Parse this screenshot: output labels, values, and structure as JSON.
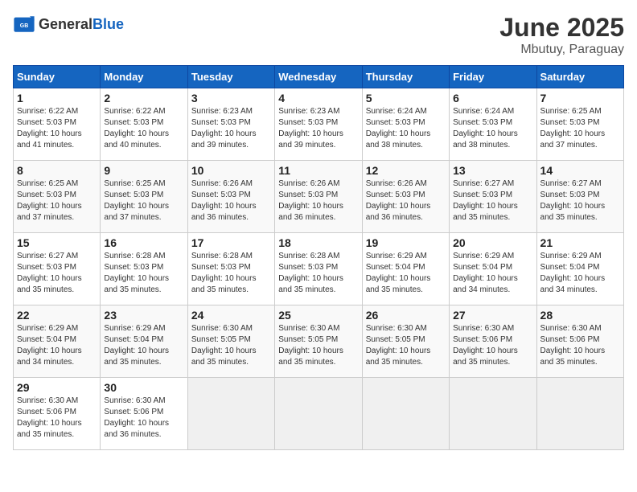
{
  "header": {
    "logo_general": "General",
    "logo_blue": "Blue",
    "title": "June 2025",
    "subtitle": "Mbutuy, Paraguay"
  },
  "calendar": {
    "days_of_week": [
      "Sunday",
      "Monday",
      "Tuesday",
      "Wednesday",
      "Thursday",
      "Friday",
      "Saturday"
    ],
    "weeks": [
      [
        null,
        null,
        null,
        null,
        null,
        null,
        null
      ]
    ],
    "cells": [
      {
        "day": null,
        "info": null
      },
      {
        "day": null,
        "info": null
      },
      {
        "day": null,
        "info": null
      },
      {
        "day": null,
        "info": null
      },
      {
        "day": null,
        "info": null
      },
      {
        "day": null,
        "info": null
      },
      {
        "day": null,
        "info": null
      },
      {
        "day": "1",
        "sunrise": "6:22 AM",
        "sunset": "5:03 PM",
        "daylight": "10 hours and 41 minutes."
      },
      {
        "day": "2",
        "sunrise": "6:22 AM",
        "sunset": "5:03 PM",
        "daylight": "10 hours and 40 minutes."
      },
      {
        "day": "3",
        "sunrise": "6:23 AM",
        "sunset": "5:03 PM",
        "daylight": "10 hours and 39 minutes."
      },
      {
        "day": "4",
        "sunrise": "6:23 AM",
        "sunset": "5:03 PM",
        "daylight": "10 hours and 39 minutes."
      },
      {
        "day": "5",
        "sunrise": "6:24 AM",
        "sunset": "5:03 PM",
        "daylight": "10 hours and 38 minutes."
      },
      {
        "day": "6",
        "sunrise": "6:24 AM",
        "sunset": "5:03 PM",
        "daylight": "10 hours and 38 minutes."
      },
      {
        "day": "7",
        "sunrise": "6:25 AM",
        "sunset": "5:03 PM",
        "daylight": "10 hours and 37 minutes."
      },
      {
        "day": "8",
        "sunrise": "6:25 AM",
        "sunset": "5:03 PM",
        "daylight": "10 hours and 37 minutes."
      },
      {
        "day": "9",
        "sunrise": "6:25 AM",
        "sunset": "5:03 PM",
        "daylight": "10 hours and 37 minutes."
      },
      {
        "day": "10",
        "sunrise": "6:26 AM",
        "sunset": "5:03 PM",
        "daylight": "10 hours and 36 minutes."
      },
      {
        "day": "11",
        "sunrise": "6:26 AM",
        "sunset": "5:03 PM",
        "daylight": "10 hours and 36 minutes."
      },
      {
        "day": "12",
        "sunrise": "6:26 AM",
        "sunset": "5:03 PM",
        "daylight": "10 hours and 36 minutes."
      },
      {
        "day": "13",
        "sunrise": "6:27 AM",
        "sunset": "5:03 PM",
        "daylight": "10 hours and 35 minutes."
      },
      {
        "day": "14",
        "sunrise": "6:27 AM",
        "sunset": "5:03 PM",
        "daylight": "10 hours and 35 minutes."
      },
      {
        "day": "15",
        "sunrise": "6:27 AM",
        "sunset": "5:03 PM",
        "daylight": "10 hours and 35 minutes."
      },
      {
        "day": "16",
        "sunrise": "6:28 AM",
        "sunset": "5:03 PM",
        "daylight": "10 hours and 35 minutes."
      },
      {
        "day": "17",
        "sunrise": "6:28 AM",
        "sunset": "5:03 PM",
        "daylight": "10 hours and 35 minutes."
      },
      {
        "day": "18",
        "sunrise": "6:28 AM",
        "sunset": "5:03 PM",
        "daylight": "10 hours and 35 minutes."
      },
      {
        "day": "19",
        "sunrise": "6:29 AM",
        "sunset": "5:04 PM",
        "daylight": "10 hours and 35 minutes."
      },
      {
        "day": "20",
        "sunrise": "6:29 AM",
        "sunset": "5:04 PM",
        "daylight": "10 hours and 34 minutes."
      },
      {
        "day": "21",
        "sunrise": "6:29 AM",
        "sunset": "5:04 PM",
        "daylight": "10 hours and 34 minutes."
      },
      {
        "day": "22",
        "sunrise": "6:29 AM",
        "sunset": "5:04 PM",
        "daylight": "10 hours and 34 minutes."
      },
      {
        "day": "23",
        "sunrise": "6:29 AM",
        "sunset": "5:04 PM",
        "daylight": "10 hours and 35 minutes."
      },
      {
        "day": "24",
        "sunrise": "6:30 AM",
        "sunset": "5:05 PM",
        "daylight": "10 hours and 35 minutes."
      },
      {
        "day": "25",
        "sunrise": "6:30 AM",
        "sunset": "5:05 PM",
        "daylight": "10 hours and 35 minutes."
      },
      {
        "day": "26",
        "sunrise": "6:30 AM",
        "sunset": "5:05 PM",
        "daylight": "10 hours and 35 minutes."
      },
      {
        "day": "27",
        "sunrise": "6:30 AM",
        "sunset": "5:06 PM",
        "daylight": "10 hours and 35 minutes."
      },
      {
        "day": "28",
        "sunrise": "6:30 AM",
        "sunset": "5:06 PM",
        "daylight": "10 hours and 35 minutes."
      },
      {
        "day": "29",
        "sunrise": "6:30 AM",
        "sunset": "5:06 PM",
        "daylight": "10 hours and 35 minutes."
      },
      {
        "day": "30",
        "sunrise": "6:30 AM",
        "sunset": "5:06 PM",
        "daylight": "10 hours and 36 minutes."
      },
      null,
      null,
      null,
      null,
      null
    ]
  }
}
